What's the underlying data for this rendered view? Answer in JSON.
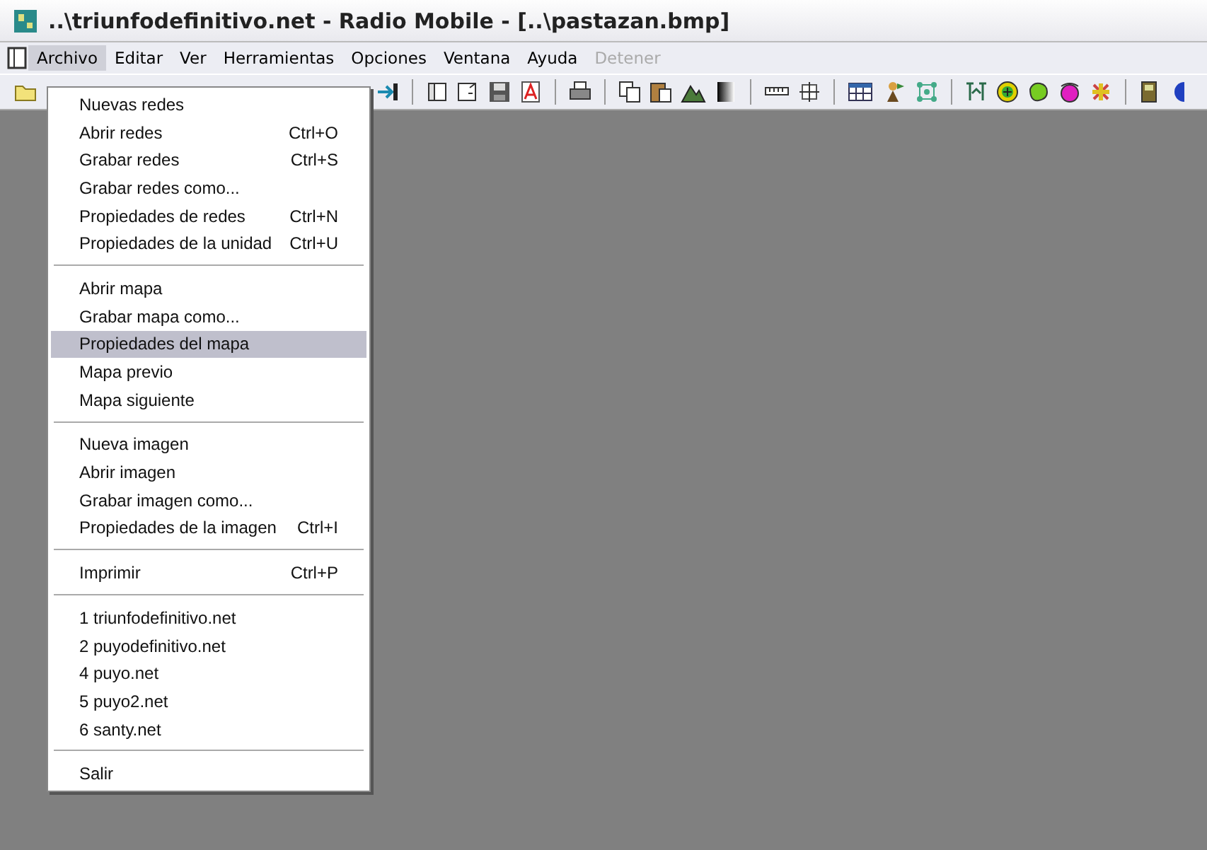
{
  "window": {
    "title": "..\\triunfodefinitivo.net - Radio Mobile - [..\\pastazan.bmp]"
  },
  "menubar": [
    {
      "label": "Archivo",
      "selected": true,
      "disabled": false
    },
    {
      "label": "Editar",
      "selected": false,
      "disabled": false
    },
    {
      "label": "Ver",
      "selected": false,
      "disabled": false
    },
    {
      "label": "Herramientas",
      "selected": false,
      "disabled": false
    },
    {
      "label": "Opciones",
      "selected": false,
      "disabled": false
    },
    {
      "label": "Ventana",
      "selected": false,
      "disabled": false
    },
    {
      "label": "Ayuda",
      "selected": false,
      "disabled": false
    },
    {
      "label": "Detener",
      "selected": false,
      "disabled": true
    }
  ],
  "menu": {
    "sections": [
      [
        {
          "label": "Nuevas redes",
          "selected": false
        },
        {
          "label": "Abrir redes",
          "shortcut": "Ctrl+O",
          "selected": false
        },
        {
          "label": "Grabar redes",
          "shortcut": "Ctrl+S",
          "selected": false
        },
        {
          "label": "Grabar redes como...",
          "selected": false
        },
        {
          "label": "Propiedades de redes",
          "shortcut": "Ctrl+N",
          "selected": false
        },
        {
          "label": "Propiedades de la unidad",
          "shortcut": "Ctrl+U",
          "selected": false
        }
      ],
      [
        {
          "label": "Abrir mapa",
          "selected": false
        },
        {
          "label": "Grabar mapa como...",
          "selected": false
        },
        {
          "label": "Propiedades del mapa",
          "selected": true
        },
        {
          "label": "Mapa previo",
          "selected": false
        },
        {
          "label": "Mapa siguiente",
          "selected": false
        }
      ],
      [
        {
          "label": "Nueva imagen",
          "selected": false
        },
        {
          "label": "Abrir imagen",
          "selected": false
        },
        {
          "label": "Grabar imagen como...",
          "selected": false
        },
        {
          "label": "Propiedades de la imagen",
          "shortcut": "Ctrl+I",
          "selected": false
        }
      ],
      [
        {
          "label": "Imprimir",
          "shortcut": "Ctrl+P",
          "selected": false
        }
      ],
      [
        {
          "label": "1 triunfodefinitivo.net",
          "selected": false
        },
        {
          "label": "2 puyodefinitivo.net",
          "selected": false
        },
        {
          "label": "4 puyo.net",
          "selected": false
        },
        {
          "label": "5 puyo2.net",
          "selected": false
        },
        {
          "label": "6 santy.net",
          "selected": false
        }
      ],
      [
        {
          "label": "Salir",
          "selected": false
        }
      ]
    ]
  }
}
